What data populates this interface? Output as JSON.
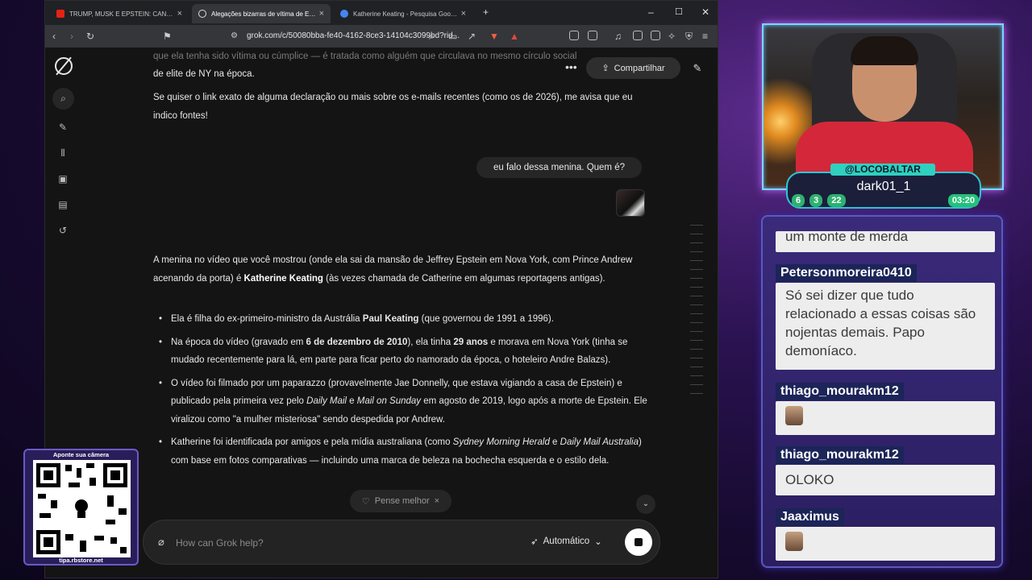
{
  "browser": {
    "tabs": [
      {
        "title": "TRUMP, MUSK E EPSTEIN: CANIBALISMO",
        "active": false
      },
      {
        "title": "Alegações bizarras de vítima de Epstein",
        "active": true
      },
      {
        "title": "Katherine Keating - Pesquisa Google",
        "active": false
      }
    ],
    "url": "grok.com/c/50080bba-fe40-4162-8ce3-14104c3099bd?rid..."
  },
  "header": {
    "share_label": "Compartilhar"
  },
  "conversation": {
    "faded_line1": "que ela tenha sido vítima ou cúmplice — é tratada como alguém que circulava no mesmo círculo social",
    "faded_line2": "de elite de NY na época.",
    "prev_para": "Se quiser o link exato de alguma declaração ou mais sobre os e-mails recentes (como os de 2026), me avisa que eu indico fontes!",
    "user_msg": "eu falo dessa menina. Quem é?",
    "intro_a": "A menina no vídeo que você mostrou (onde ela sai da mansão de Jeffrey Epstein em Nova York, com Prince Andrew acenando da porta) é ",
    "intro_bold": "Katherine Keating",
    "intro_b": " (às vezes chamada de Catherine em algumas reportagens antigas).",
    "b1_a": "Ela é filha do ex-primeiro-ministro da Austrália ",
    "b1_bold": "Paul Keating",
    "b1_b": " (que governou de 1991 a 1996).",
    "b2_a": "Na época do vídeo (gravado em ",
    "b2_bold1": "6 de dezembro de 2010",
    "b2_b": "), ela tinha ",
    "b2_bold2": "29 anos",
    "b2_c": " e morava em Nova York (tinha se mudado recentemente para lá, em parte para ficar perto do namorado da época, o hoteleiro Andre Balazs).",
    "b3_a": "O vídeo foi filmado por um paparazzo (provavelmente Jae Donnelly, que estava vigiando a casa de Epstein) e publicado pela primeira vez pelo ",
    "b3_i1": "Daily Mail",
    "b3_b": " e ",
    "b3_i2": "Mail on Sunday",
    "b3_c": " em agosto de 2019, logo após a morte de Epstein. Ele viralizou como \"a mulher misteriosa\" sendo despedida por Andrew.",
    "b4_a": "Katherine foi identificada por amigos e pela mídia australiana (como ",
    "b4_i1": "Sydney Morning Herald",
    "b4_b": " e ",
    "b4_i2": "Daily Mail Australia",
    "b4_c": ") com base em fotos comparativas — incluindo uma marca de beleza na bochecha esquerda e o estilo dela."
  },
  "composer": {
    "think_chip": "Pense melhor",
    "placeholder": "How can Grok help?",
    "mode": "Automático"
  },
  "camera": {
    "handle": "@LOCOBALTAR",
    "viewer": "dark01_1",
    "stats": [
      "6",
      "3",
      "22",
      "03:20"
    ]
  },
  "chat": {
    "partial": "um monte de merda",
    "messages": [
      {
        "user": "Petersonmoreira0410",
        "text": "Só sei dizer que tudo relacionado a essas coisas são nojentas demais. Papo demoníaco."
      },
      {
        "user": "thiago_mourakm12",
        "text": ""
      },
      {
        "user": "thiago_mourakm12",
        "text": "OLOKO"
      },
      {
        "user": "Jaaximus",
        "text": ""
      }
    ]
  },
  "qr": {
    "top": "Aponte sua câmera",
    "bottom": "tipa.rbstore.net"
  }
}
